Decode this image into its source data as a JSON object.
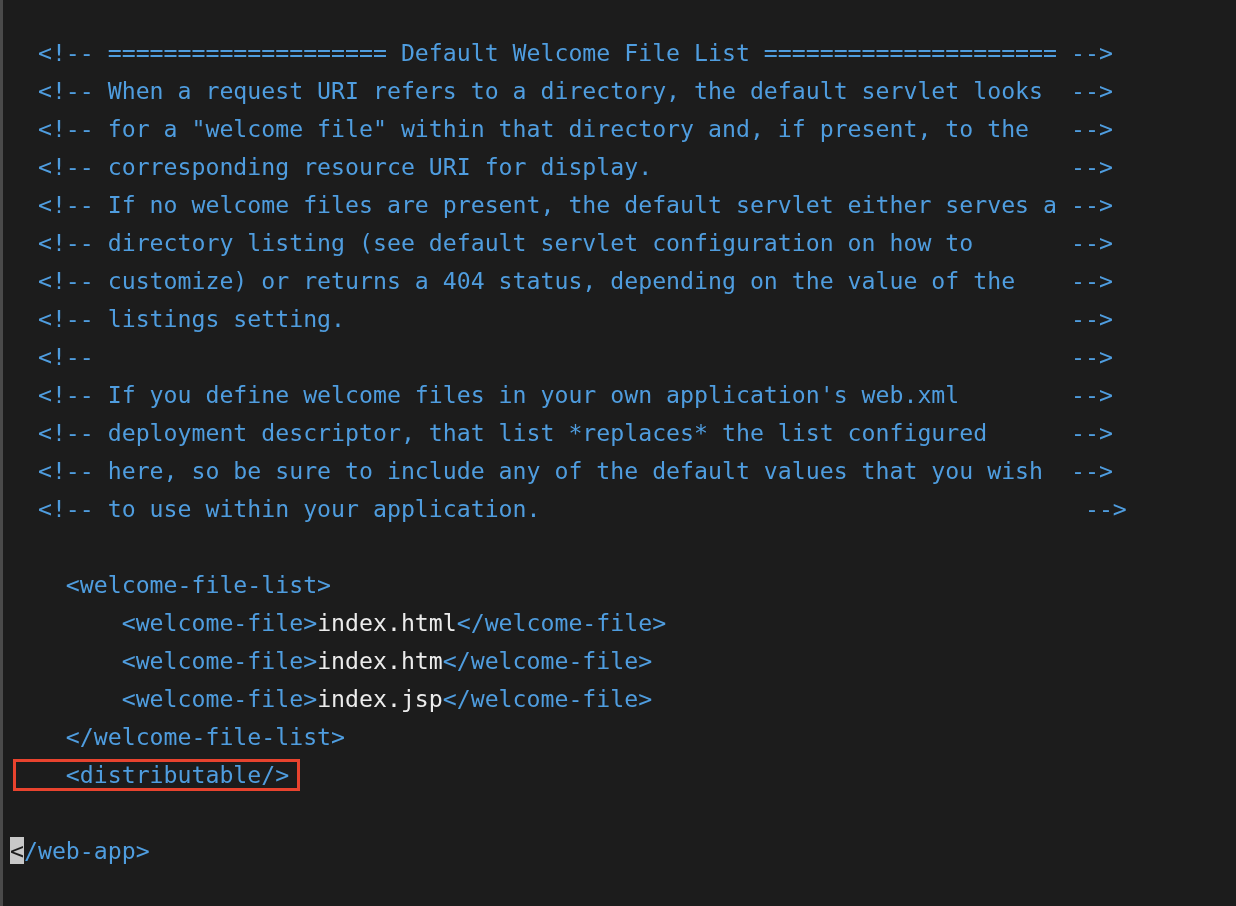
{
  "editor": {
    "lines": [
      {
        "kind": "code",
        "highlighted": false,
        "segments": [
          {
            "kind": "comment",
            "text": "  <!-- ==================== Default Welcome File List ===================== -->",
            "cursor": false
          }
        ]
      },
      {
        "kind": "code",
        "highlighted": false,
        "segments": [
          {
            "kind": "comment",
            "text": "  <!-- When a request URI refers to a directory, the default servlet looks  -->",
            "cursor": false
          }
        ]
      },
      {
        "kind": "code",
        "highlighted": false,
        "segments": [
          {
            "kind": "comment",
            "text": "  <!-- for a \"welcome file\" within that directory and, if present, to the   -->",
            "cursor": false
          }
        ]
      },
      {
        "kind": "code",
        "highlighted": false,
        "segments": [
          {
            "kind": "comment",
            "text": "  <!-- corresponding resource URI for display.                              -->",
            "cursor": false
          }
        ]
      },
      {
        "kind": "code",
        "highlighted": false,
        "segments": [
          {
            "kind": "comment",
            "text": "  <!-- If no welcome files are present, the default servlet either serves a -->",
            "cursor": false
          }
        ]
      },
      {
        "kind": "code",
        "highlighted": false,
        "segments": [
          {
            "kind": "comment",
            "text": "  <!-- directory listing (see default servlet configuration on how to       -->",
            "cursor": false
          }
        ]
      },
      {
        "kind": "code",
        "highlighted": false,
        "segments": [
          {
            "kind": "comment",
            "text": "  <!-- customize) or returns a 404 status, depending on the value of the    -->",
            "cursor": false
          }
        ]
      },
      {
        "kind": "code",
        "highlighted": false,
        "segments": [
          {
            "kind": "comment",
            "text": "  <!-- listings setting.                                                    -->",
            "cursor": false
          }
        ]
      },
      {
        "kind": "code",
        "highlighted": false,
        "segments": [
          {
            "kind": "comment",
            "text": "  <!--                                                                      -->",
            "cursor": false
          }
        ]
      },
      {
        "kind": "code",
        "highlighted": false,
        "segments": [
          {
            "kind": "comment",
            "text": "  <!-- If you define welcome files in your own application's web.xml        -->",
            "cursor": false
          }
        ]
      },
      {
        "kind": "code",
        "highlighted": false,
        "segments": [
          {
            "kind": "comment",
            "text": "  <!-- deployment descriptor, that list *replaces* the list configured      -->",
            "cursor": false
          }
        ]
      },
      {
        "kind": "code",
        "highlighted": false,
        "segments": [
          {
            "kind": "comment",
            "text": "  <!-- here, so be sure to include any of the default values that you wish  -->",
            "cursor": false
          }
        ]
      },
      {
        "kind": "code",
        "highlighted": false,
        "segments": [
          {
            "kind": "comment",
            "text": "  <!-- to use within your application.                                       -->",
            "cursor": false
          }
        ]
      },
      {
        "kind": "blank"
      },
      {
        "kind": "code",
        "highlighted": false,
        "segments": [
          {
            "kind": "tag",
            "text": "    <welcome-file-list>",
            "cursor": false
          }
        ]
      },
      {
        "kind": "code",
        "highlighted": false,
        "segments": [
          {
            "kind": "tag",
            "text": "        <welcome-file>",
            "cursor": false
          },
          {
            "kind": "text",
            "text": "index.html",
            "cursor": false
          },
          {
            "kind": "tag",
            "text": "</welcome-file>",
            "cursor": false
          }
        ]
      },
      {
        "kind": "code",
        "highlighted": false,
        "segments": [
          {
            "kind": "tag",
            "text": "        <welcome-file>",
            "cursor": false
          },
          {
            "kind": "text",
            "text": "index.htm",
            "cursor": false
          },
          {
            "kind": "tag",
            "text": "</welcome-file>",
            "cursor": false
          }
        ]
      },
      {
        "kind": "code",
        "highlighted": false,
        "segments": [
          {
            "kind": "tag",
            "text": "        <welcome-file>",
            "cursor": false
          },
          {
            "kind": "text",
            "text": "index.jsp",
            "cursor": false
          },
          {
            "kind": "tag",
            "text": "</welcome-file>",
            "cursor": false
          }
        ]
      },
      {
        "kind": "code",
        "highlighted": false,
        "segments": [
          {
            "kind": "tag",
            "text": "    </welcome-file-list>",
            "cursor": false
          }
        ]
      },
      {
        "kind": "code",
        "highlighted": true,
        "segments": [
          {
            "kind": "tag",
            "text": "    <distributable/>",
            "cursor": false
          }
        ]
      },
      {
        "kind": "blank"
      },
      {
        "kind": "code",
        "highlighted": false,
        "segments": [
          {
            "kind": "tag",
            "text": "<",
            "cursor": true
          },
          {
            "kind": "tag",
            "text": "/web-app>",
            "cursor": false
          }
        ]
      }
    ]
  }
}
